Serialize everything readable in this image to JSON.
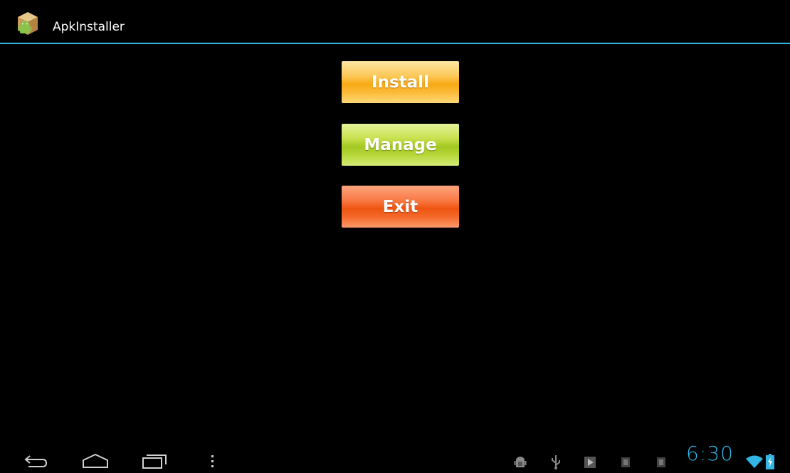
{
  "app": {
    "title": "ApkInstaller"
  },
  "buttons": {
    "install": "Install",
    "manage": "Manage",
    "exit": "Exit"
  },
  "status_bar": {
    "time": "6:30",
    "icons": [
      "android-debug-icon",
      "usb-icon",
      "play-store-icon",
      "notification-icon",
      "notification-icon",
      "wifi-icon",
      "battery-charging-icon"
    ]
  },
  "nav_bar": {
    "icons": [
      "back-icon",
      "home-icon",
      "recent-apps-icon",
      "menu-icon"
    ]
  },
  "colors": {
    "accent": "#33b5e5",
    "install": "#f8a915",
    "manage": "#a3c821",
    "exit": "#ee5410"
  }
}
